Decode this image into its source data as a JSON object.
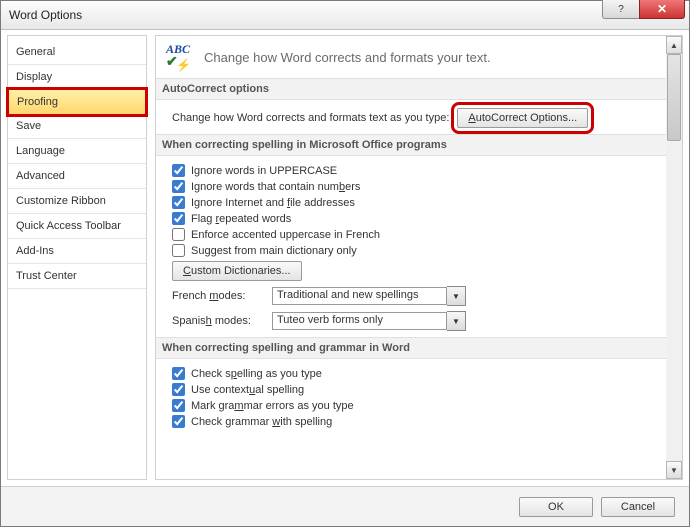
{
  "window": {
    "title": "Word Options"
  },
  "sidebar": {
    "items": [
      {
        "label": "General"
      },
      {
        "label": "Display"
      },
      {
        "label": "Proofing"
      },
      {
        "label": "Save"
      },
      {
        "label": "Language"
      },
      {
        "label": "Advanced"
      },
      {
        "label": "Customize Ribbon"
      },
      {
        "label": "Quick Access Toolbar"
      },
      {
        "label": "Add-Ins"
      },
      {
        "label": "Trust Center"
      }
    ],
    "selected_index": 2
  },
  "heading": "Change how Word corrects and formats your text.",
  "group_autocorrect": {
    "title": "AutoCorrect options",
    "desc": "Change how Word corrects and formats text as you type:",
    "button": "AutoCorrect Options..."
  },
  "group_spell_office": {
    "title": "When correcting spelling in Microsoft Office programs",
    "checks": [
      {
        "label": "Ignore words in UPPERCASE",
        "checked": true
      },
      {
        "label": "Ignore words that contain numbers",
        "checked": true
      },
      {
        "label": "Ignore Internet and file addresses",
        "checked": true
      },
      {
        "label": "Flag repeated words",
        "checked": true
      },
      {
        "label": "Enforce accented uppercase in French",
        "checked": false
      },
      {
        "label": "Suggest from main dictionary only",
        "checked": false
      }
    ],
    "custom_dict_btn": "Custom Dictionaries...",
    "french_label": "French modes:",
    "french_value": "Traditional and new spellings",
    "spanish_label": "Spanish modes:",
    "spanish_value": "Tuteo verb forms only"
  },
  "group_spell_word": {
    "title": "When correcting spelling and grammar in Word",
    "checks": [
      {
        "label": "Check spelling as you type",
        "checked": true
      },
      {
        "label": "Use contextual spelling",
        "checked": true
      },
      {
        "label": "Mark grammar errors as you type",
        "checked": true
      },
      {
        "label": "Check grammar with spelling",
        "checked": true
      }
    ]
  },
  "footer": {
    "ok": "OK",
    "cancel": "Cancel"
  }
}
